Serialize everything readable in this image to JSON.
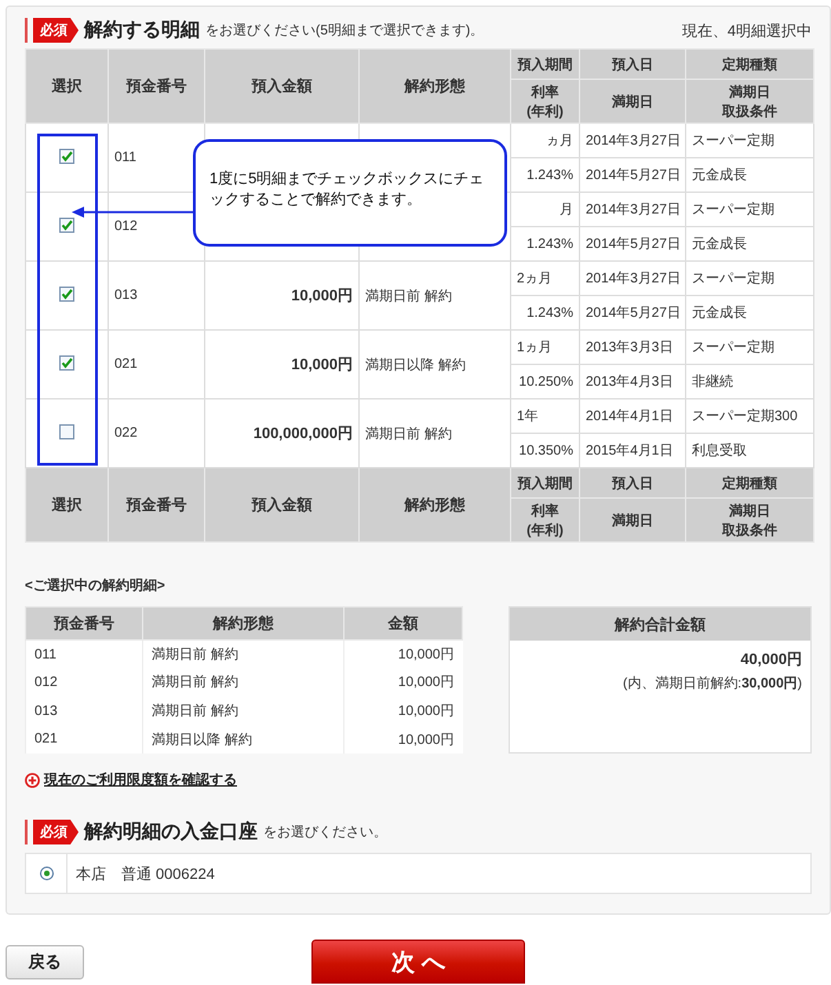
{
  "section1": {
    "badge": "必須",
    "title": "解約する明細",
    "note": "をお選びください(5明細まで選択できます)。",
    "status": "現在、4明細選択中"
  },
  "table": {
    "columns": [
      "選択",
      "預金番号",
      "預入金額",
      "解約形態"
    ],
    "subcolumns": [
      {
        "top": "預入期間",
        "bottom": [
          "利率",
          "(年利)"
        ]
      },
      {
        "top": "預入日",
        "bottom": [
          "満期日"
        ]
      },
      {
        "top": "定期種類",
        "bottom": [
          "満期日",
          "取扱条件"
        ]
      }
    ],
    "rows": [
      {
        "checked": true,
        "number": "011",
        "period": "ヵ月",
        "rate": "1.243%",
        "start": "2014年3月27日",
        "maturity": "2014年5月27日",
        "plan": "スーパー定期",
        "condition": "元金成長"
      },
      {
        "checked": true,
        "number": "012",
        "period": "月",
        "rate": "1.243%",
        "start": "2014年3月27日",
        "maturity": "2014年5月27日",
        "plan": "スーパー定期",
        "condition": "元金成長"
      },
      {
        "checked": true,
        "number": "013",
        "amount": "10,000円",
        "type": "満期日前 解約",
        "period": "2ヵ月",
        "rate": "1.243%",
        "start": "2014年3月27日",
        "maturity": "2014年5月27日",
        "plan": "スーパー定期",
        "condition": "元金成長"
      },
      {
        "checked": true,
        "number": "021",
        "amount": "10,000円",
        "type": "満期日以降 解約",
        "period": "1ヵ月",
        "rate": "10.250%",
        "start": "2013年3月3日",
        "maturity": "2013年4月3日",
        "plan": "スーパー定期",
        "condition": "非継続"
      },
      {
        "checked": false,
        "number": "022",
        "amount": "100,000,000円",
        "type": "満期日前 解約",
        "period": "1年",
        "rate": "10.350%",
        "start": "2014年4月1日",
        "maturity": "2015年4月1日",
        "plan": "スーパー定期300",
        "condition": "利息受取"
      }
    ],
    "footer_columns": [
      "選択",
      "預金番号",
      "預入金額",
      "解約形態"
    ],
    "footer_subcolumns": [
      {
        "top": "預入期間",
        "bottom": [
          "利率",
          "(年利)"
        ]
      },
      {
        "top": "預入日",
        "bottom": [
          "満期日"
        ]
      },
      {
        "top": "定期種類",
        "bottom": [
          "満期日",
          "取扱条件"
        ]
      }
    ]
  },
  "callout": {
    "text": "1度に5明細までチェックボックスにチェックすることで解約できます。"
  },
  "summary": {
    "title": "<ご選択中の解約明細>",
    "columns": [
      "預金番号",
      "解約形態",
      "金額"
    ],
    "rows": [
      [
        "011",
        "満期日前 解約",
        "10,000円"
      ],
      [
        "012",
        "満期日前 解約",
        "10,000円"
      ],
      [
        "013",
        "満期日前 解約",
        "10,000円"
      ],
      [
        "021",
        "満期日以降 解約",
        "10,000円"
      ]
    ],
    "total_header": "解約合計金額",
    "total": "40,000円",
    "breakdown": "(内、満期日前解約:**30,000円**)"
  },
  "link": "現在のご利用限度額を確認する",
  "section2": {
    "badge": "必須",
    "title": "解約明細の入金口座",
    "note": "をお選びください。"
  },
  "accounts": [
    {
      "label": "本店　普通 0006224",
      "selected": true
    }
  ],
  "buttons": {
    "back": "戻る",
    "next": "次 へ"
  }
}
